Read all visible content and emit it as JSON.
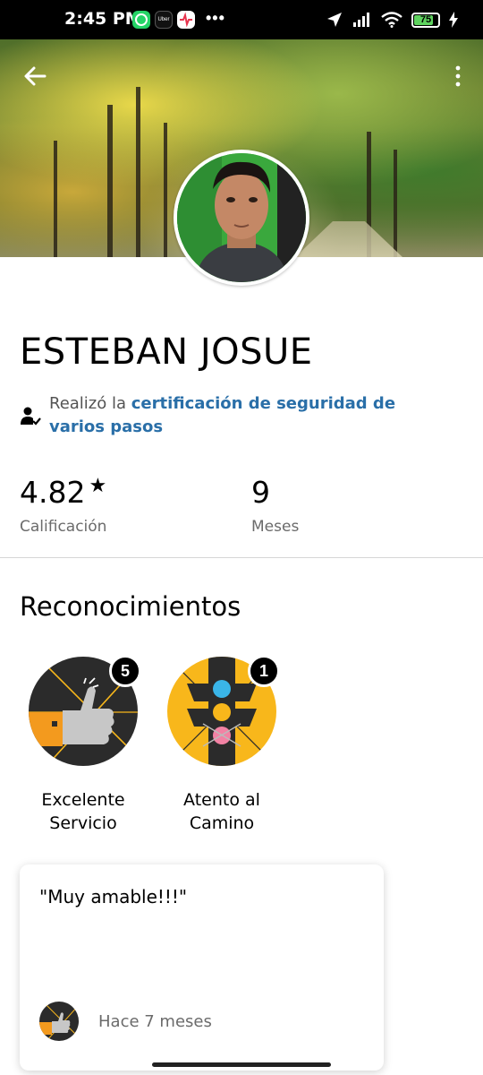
{
  "status_bar": {
    "time": "2:45 PM",
    "more": "•••",
    "battery": "75",
    "apps": [
      "whatsapp-icon",
      "uber-icon",
      "health-icon"
    ],
    "uber_label": "Uber"
  },
  "header": {
    "back_icon": "arrow-left-icon",
    "menu_icon": "more-vertical-icon"
  },
  "profile": {
    "name": "ESTEBAN JOSUE",
    "certification_prefix": "Realizó la ",
    "certification_link": "certificación de seguridad de varios pasos"
  },
  "stats": [
    {
      "value": "4.82",
      "label": "Calificación",
      "icon": "star-icon"
    },
    {
      "value": "9",
      "label": "Meses"
    }
  ],
  "compliments": {
    "title": "Reconocimientos",
    "items": [
      {
        "label": "Excelente Servicio",
        "count": "5",
        "icon": "thumbs-up-icon"
      },
      {
        "label": "Atento al Camino",
        "count": "1",
        "icon": "traffic-light-icon"
      }
    ]
  },
  "review": {
    "text": "\"Muy amable!!!\"",
    "time": "Hace 7 meses"
  },
  "colors": {
    "link": "#2a6fa8",
    "badge_dark": "#2b2b2b",
    "badge_yellow": "#f8b71b",
    "badge_orange": "#f39a1e"
  }
}
